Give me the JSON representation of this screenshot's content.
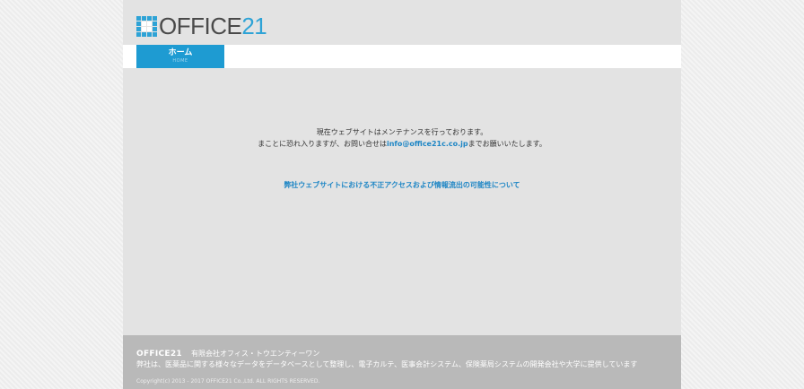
{
  "header": {
    "logo": {
      "part1": "OFFICE",
      "part2": "21"
    }
  },
  "nav": {
    "items": [
      {
        "label": "ホーム",
        "sublabel": "HOME"
      }
    ]
  },
  "content": {
    "message_line1": "現在ウェブサイトはメンテナンスを行っております。",
    "message_line2_pre": "まことに恐れ入りますが、お問い合せは",
    "email": "info@office21c.co.jp",
    "message_line2_post": "までお願いいたします。",
    "notice_link": "弊社ウェブサイトにおける不正アクセスおよび情報流出の可能性について"
  },
  "footer": {
    "brand": "OFFICE21",
    "company": "有限会社オフィス・トウエンティーワン",
    "description": "弊社は、医薬品に関する様々なデータをデータベースとして整理し、電子カルテ、医事会計システム、保険薬局システムの開発会社や大学に提供しています",
    "copyright": "Copyright(c) 2013 - 2017 OFFICE21 Co.,Ltd. ALL RIGHTS RESERVED."
  },
  "colors": {
    "accent": "#1e9bd2",
    "link": "#1e86c5",
    "footer_bg": "#b9b9b9",
    "page_bg": "#e3e3e3"
  }
}
